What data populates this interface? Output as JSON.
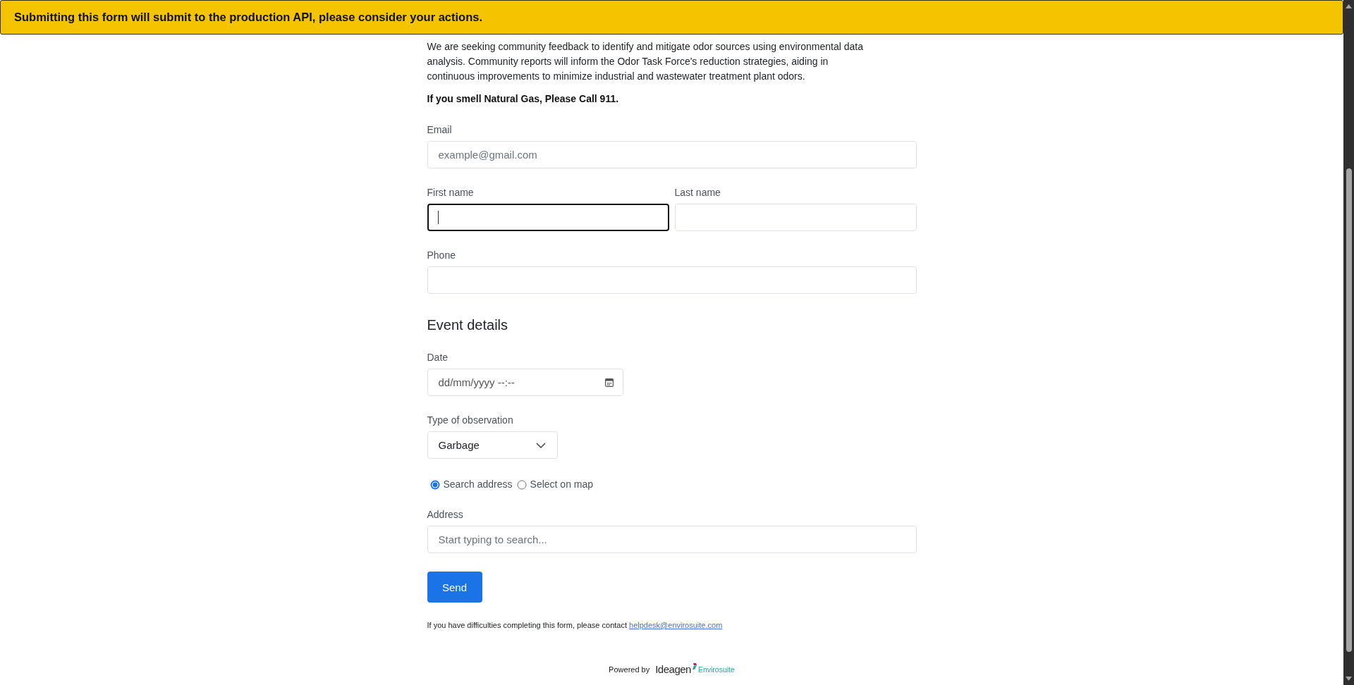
{
  "banner": {
    "text": "Submitting this form will submit to the production API, please consider your actions."
  },
  "intro": {
    "paragraph": "We are seeking community feedback to identify and mitigate odor sources using environmental data\nanalysis. Community reports will inform the Odor Task Force's reduction strategies, aiding in\ncontinuous improvements to minimize industrial and wastewater treatment plant odors.",
    "notice": "If you smell Natural Gas, Please Call 911."
  },
  "contact": {
    "rows": [
      {
        "fields": [
          {
            "label": "Email",
            "placeholder": "example@gmail.com",
            "focused": false
          }
        ]
      },
      {
        "fields": [
          {
            "label": "First name",
            "focused": true
          },
          {
            "label": "Last name",
            "focused": false
          }
        ]
      },
      {
        "fields": [
          {
            "label": "Phone",
            "focused": false
          }
        ]
      }
    ]
  },
  "event_details": {
    "heading": "Event details",
    "date": {
      "label": "Date",
      "placeholder": "dd/mm/yyyy --:--"
    },
    "observation": {
      "label": "Type of observation",
      "value": "Garbage"
    },
    "location_mode": [
      {
        "label": "Search address",
        "selected": true
      },
      {
        "label": "Select on map",
        "selected": false
      }
    ],
    "address": {
      "label": "Address",
      "placeholder": "Start typing to search..."
    }
  },
  "send_button": {
    "label": "Send"
  },
  "help": {
    "text": "If you have difficulties completing this form, please contact",
    "link": "helpdesk@envirosuite.com"
  },
  "footer": {
    "powered_by": "Powered by",
    "logo_name": "Ideagen",
    "logo_product": "Envirosuite"
  }
}
